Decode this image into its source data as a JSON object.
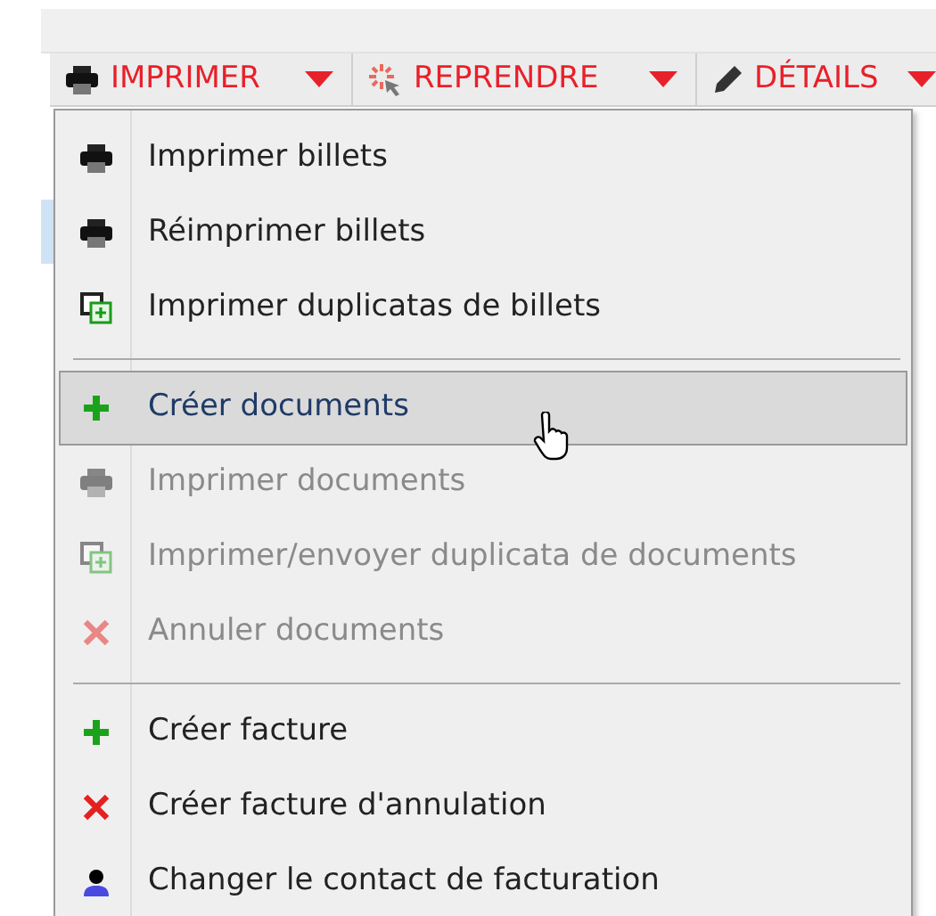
{
  "toolbar": {
    "buttons": [
      {
        "label": "IMPRIMER",
        "kind": "printer"
      },
      {
        "label": "REPRENDRE",
        "kind": "sparkle"
      },
      {
        "label": "DÉTAILS",
        "kind": "pencil"
      }
    ]
  },
  "menu": {
    "items": [
      {
        "kind": "printer",
        "label": "Imprimer billets",
        "disabled": false,
        "selected": false
      },
      {
        "kind": "printer",
        "label": "Réimprimer billets",
        "disabled": false,
        "selected": false
      },
      {
        "kind": "duplicate",
        "label": "Imprimer duplicatas de billets",
        "disabled": false,
        "selected": false
      },
      {
        "kind": "separator"
      },
      {
        "kind": "plus",
        "label": "Créer documents",
        "disabled": false,
        "selected": true
      },
      {
        "kind": "printer",
        "label": "Imprimer documents",
        "disabled": true,
        "selected": false
      },
      {
        "kind": "duplicate",
        "label": "Imprimer/envoyer duplicata de documents",
        "disabled": true,
        "selected": false
      },
      {
        "kind": "cross",
        "label": "Annuler documents",
        "disabled": true,
        "selected": false
      },
      {
        "kind": "separator"
      },
      {
        "kind": "plus",
        "label": "Créer facture",
        "disabled": false,
        "selected": false
      },
      {
        "kind": "cross",
        "label": "Créer facture d'annulation",
        "disabled": false,
        "selected": false
      },
      {
        "kind": "user",
        "label": "Changer le contact de facturation",
        "disabled": false,
        "selected": false
      }
    ]
  }
}
